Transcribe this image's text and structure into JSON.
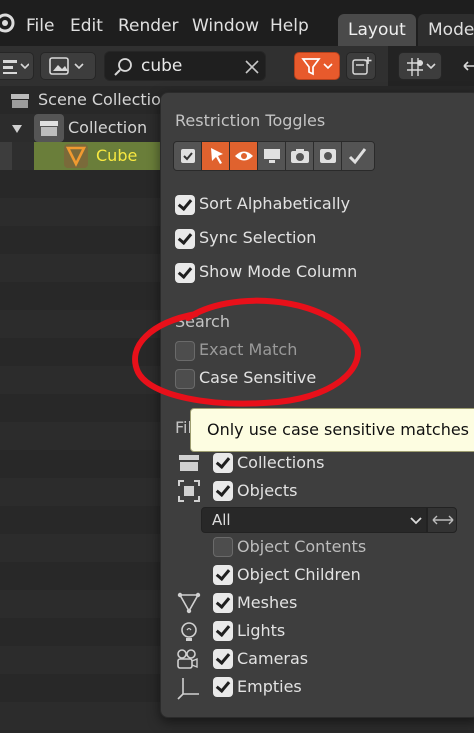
{
  "menubar": {
    "items": [
      "File",
      "Edit",
      "Render",
      "Window",
      "Help"
    ],
    "tabs": [
      {
        "label": "Layout",
        "active": true
      },
      {
        "label": "Model",
        "active": false
      }
    ]
  },
  "outliner": {
    "search_value": "cube",
    "tree": [
      {
        "label": "Scene Collection",
        "icon": "scene-collection-icon"
      },
      {
        "label": "Collection",
        "icon": "collection-icon"
      },
      {
        "label": "Cube",
        "icon": "mesh-object-icon",
        "selected": true
      }
    ]
  },
  "popup": {
    "restriction_label": "Restriction Toggles",
    "restriction_toggles": [
      {
        "icon": "checkbox-toggle-icon",
        "active": false
      },
      {
        "icon": "select-arrow-icon",
        "active": true
      },
      {
        "icon": "eye-icon",
        "active": true
      },
      {
        "icon": "monitor-icon",
        "active": false
      },
      {
        "icon": "camera-render-icon",
        "active": false
      },
      {
        "icon": "holdout-icon",
        "active": false
      },
      {
        "icon": "indirect-only-icon",
        "active": false
      }
    ],
    "options": {
      "sort_alphabetically": {
        "label": "Sort Alphabetically",
        "checked": true
      },
      "sync_selection": {
        "label": "Sync Selection",
        "checked": true
      },
      "show_mode_column": {
        "label": "Show Mode Column",
        "checked": true
      }
    },
    "search_label": "Search",
    "exact_match": {
      "label": "Exact Match",
      "checked": false
    },
    "case_sensitive": {
      "label": "Case Sensitive",
      "checked": false
    },
    "filter_label_visible": "Fil",
    "filters": {
      "collections": {
        "label": "Collections",
        "checked": true,
        "icon": "collection-icon"
      },
      "objects": {
        "label": "Objects",
        "checked": true,
        "icon": "objects-icon"
      },
      "objects_dropdown": "All",
      "object_contents": {
        "label": "Object Contents",
        "checked": false
      },
      "object_children": {
        "label": "Object Children",
        "checked": true
      },
      "meshes": {
        "label": "Meshes",
        "checked": true,
        "icon": "mesh-icon"
      },
      "lights": {
        "label": "Lights",
        "checked": true,
        "icon": "light-icon"
      },
      "cameras": {
        "label": "Cameras",
        "checked": true,
        "icon": "camera-icon"
      },
      "empties": {
        "label": "Empties",
        "checked": true,
        "icon": "empty-icon"
      }
    }
  },
  "tooltip": {
    "text": "Only use case sensitive matches of s"
  },
  "colors": {
    "accent_red": "#e85a2c",
    "selected_row": "#6a7e3a",
    "annotation_red": "#e8101a",
    "active_toggle": "#e0622e"
  }
}
